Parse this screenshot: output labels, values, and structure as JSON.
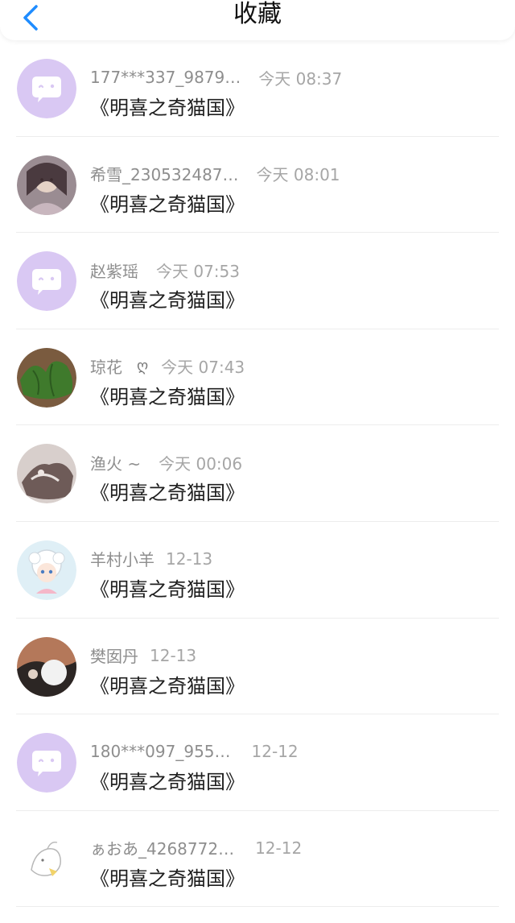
{
  "header": {
    "title": "收藏",
    "back_icon": "chevron-left-icon",
    "accent": "#1E8CFF"
  },
  "items": [
    {
      "name": "177***337_9879…",
      "time": "今天 08:37",
      "book": "《明喜之奇猫国》",
      "avatar": "default"
    },
    {
      "name": "希雪_230532487…",
      "time": "今天 08:01",
      "book": "《明喜之奇猫国》",
      "avatar": "photo"
    },
    {
      "name": "赵紫瑶",
      "time": "今天 07:53",
      "book": "《明喜之奇猫国》",
      "avatar": "default"
    },
    {
      "name": "琼花",
      "badge": "ღ",
      "time": "今天 07:43",
      "book": "《明喜之奇猫国》",
      "avatar": "plant"
    },
    {
      "name": "渔火 ~",
      "time": "今天 00:06",
      "book": "《明喜之奇猫国》",
      "avatar": "photo2"
    },
    {
      "name": "羊村小羊",
      "time": "12-13",
      "book": "《明喜之奇猫国》",
      "avatar": "sheep"
    },
    {
      "name": "樊囡丹",
      "time": "12-13",
      "book": "《明喜之奇猫国》",
      "avatar": "photo3"
    },
    {
      "name": "180***097_955…",
      "time": "12-12",
      "book": "《明喜之奇猫国》",
      "avatar": "default"
    },
    {
      "name": "ぁおあ_4268772…",
      "time": "12-12",
      "book": "《明喜之奇猫国》",
      "avatar": "sketch"
    }
  ],
  "colors": {
    "default_avatar_bg": "#D9C8F3",
    "default_avatar_fg": "#ffffff"
  }
}
